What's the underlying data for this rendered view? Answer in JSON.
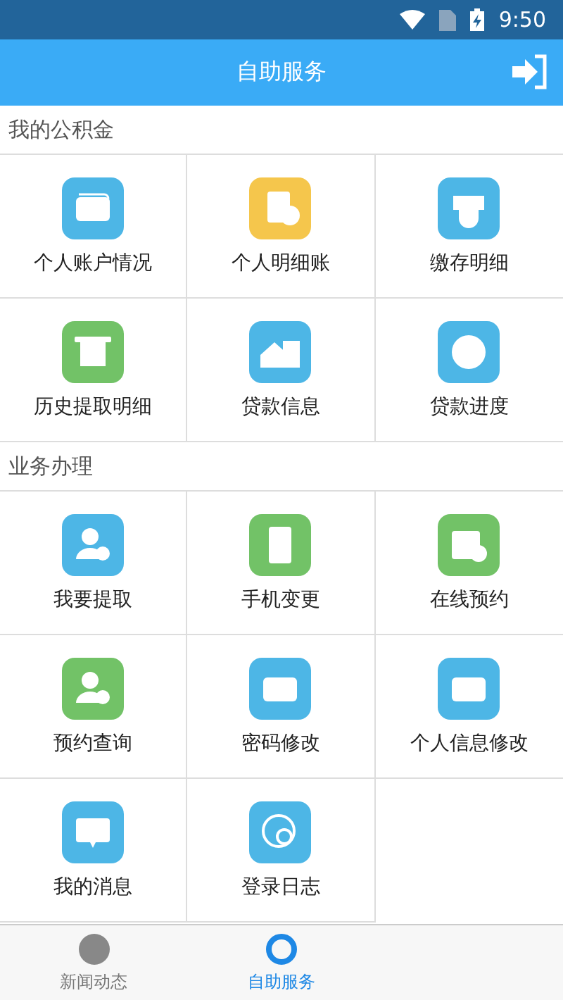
{
  "status_bar": {
    "time": "9:50"
  },
  "header": {
    "title": "自助服务"
  },
  "sections": [
    {
      "title": "我的公积金",
      "items": [
        {
          "label": "个人账户情况",
          "color": "#4db6e6"
        },
        {
          "label": "个人明细账",
          "color": "#f5c64c"
        },
        {
          "label": "缴存明细",
          "color": "#4db6e6"
        },
        {
          "label": "历史提取明细",
          "color": "#72c267"
        },
        {
          "label": "贷款信息",
          "color": "#4db6e6"
        },
        {
          "label": "贷款进度",
          "color": "#4db6e6"
        }
      ]
    },
    {
      "title": "业务办理",
      "items": [
        {
          "label": "我要提取",
          "color": "#4db6e6"
        },
        {
          "label": "手机变更",
          "color": "#72c267"
        },
        {
          "label": "在线预约",
          "color": "#72c267"
        },
        {
          "label": "预约查询",
          "color": "#72c267"
        },
        {
          "label": "密码修改",
          "color": "#4db6e6"
        },
        {
          "label": "个人信息修改",
          "color": "#4db6e6"
        },
        {
          "label": "我的消息",
          "color": "#4db6e6"
        },
        {
          "label": "登录日志",
          "color": "#4db6e6"
        }
      ]
    }
  ],
  "bottom_nav": [
    {
      "label": "新闻动态",
      "selected": false
    },
    {
      "label": "自助服务",
      "selected": true
    }
  ]
}
